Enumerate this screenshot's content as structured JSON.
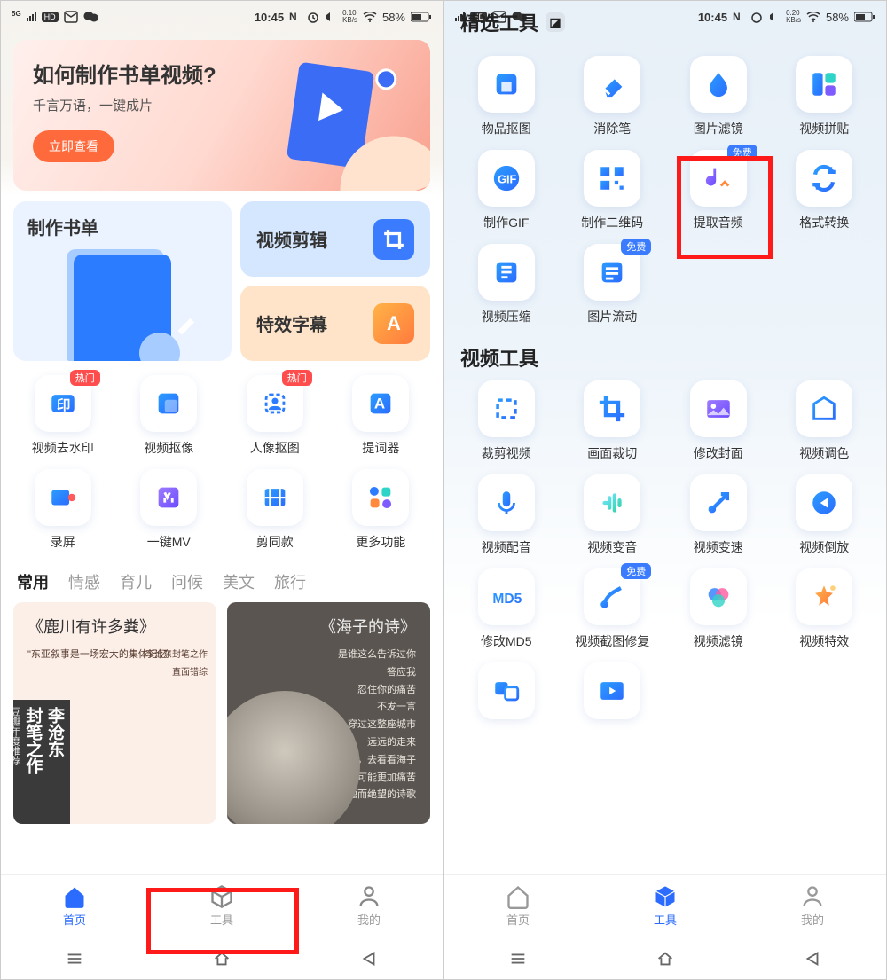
{
  "status": {
    "net": "5G",
    "hd": "HD",
    "time": "10:45",
    "speed_l": "0.10",
    "speed_unit": "KB/s",
    "speed_r": "0.20",
    "battery": "58%"
  },
  "left": {
    "banner": {
      "title": "如何制作书单视频?",
      "subtitle": "千言万语，一键成片",
      "cta": "立即查看"
    },
    "cards": {
      "big": "制作书单",
      "video_edit": "视频剪辑",
      "fx": "特效字幕"
    },
    "badges": {
      "hot": "热门"
    },
    "tools": [
      {
        "label": "视频去水印",
        "hot": true,
        "icon": "watermark"
      },
      {
        "label": "视频抠像",
        "icon": "cutout"
      },
      {
        "label": "人像抠图",
        "hot": true,
        "icon": "portrait"
      },
      {
        "label": "提词器",
        "icon": "prompter"
      },
      {
        "label": "录屏",
        "icon": "record"
      },
      {
        "label": "一键MV",
        "icon": "mv"
      },
      {
        "label": "剪同款",
        "icon": "film"
      },
      {
        "label": "更多功能",
        "icon": "more"
      }
    ],
    "tabs": [
      "常用",
      "情感",
      "育儿",
      "问候",
      "美文",
      "旅行"
    ],
    "card1": {
      "title": "《鹿川有许多粪》",
      "quote": "\"东亚叙事是一场宏大的集体记忆\"",
      "line1": "李沧东封笔之作",
      "line2": "直面错综",
      "strip_big": "李沧东",
      "strip_mid": "封笔之作",
      "strip_small": "豆瓣年度推荐"
    },
    "card2": {
      "title": "《海子的诗》",
      "lines": [
        "是谁这么告诉过你",
        "答应我",
        "忍住你的痛苦",
        "不发一言",
        "穿过这整座城市",
        "远远的走来",
        "去看着他，去看看海子",
        "他可能更加痛苦",
        "在写一首孤独而绝望的诗歌"
      ]
    },
    "nav": {
      "home": "首页",
      "tools": "工具",
      "mine": "我的"
    }
  },
  "right": {
    "header1": "精选工具",
    "header2": "视频工具",
    "badges": {
      "free": "免费"
    },
    "grid1": [
      {
        "label": "物品抠图",
        "icon": "box"
      },
      {
        "label": "消除笔",
        "icon": "eraser"
      },
      {
        "label": "图片滤镜",
        "icon": "drop"
      },
      {
        "label": "视频拼贴",
        "icon": "collage"
      },
      {
        "label": "制作GIF",
        "icon": "gif"
      },
      {
        "label": "制作二维码",
        "icon": "qr"
      },
      {
        "label": "提取音频",
        "icon": "audio",
        "free": true,
        "highlight": true
      },
      {
        "label": "格式转换",
        "icon": "convert"
      },
      {
        "label": "视频压缩",
        "icon": "compress"
      },
      {
        "label": "图片流动",
        "icon": "flow",
        "free": true
      }
    ],
    "grid2": [
      {
        "label": "裁剪视频",
        "icon": "trim"
      },
      {
        "label": "画面裁切",
        "icon": "crop"
      },
      {
        "label": "修改封面",
        "icon": "cover"
      },
      {
        "label": "视频调色",
        "icon": "tint"
      },
      {
        "label": "视频配音",
        "icon": "mic"
      },
      {
        "label": "视频变音",
        "icon": "voice"
      },
      {
        "label": "视频变速",
        "icon": "speed"
      },
      {
        "label": "视频倒放",
        "icon": "reverse"
      },
      {
        "label": "修改MD5",
        "icon": "md5"
      },
      {
        "label": "视频截图修复",
        "icon": "repair",
        "free": true
      },
      {
        "label": "视频滤镜",
        "icon": "vfilter"
      },
      {
        "label": "视频特效",
        "icon": "vfx"
      },
      {
        "label": "",
        "icon": "swap"
      },
      {
        "label": "",
        "icon": "play2"
      }
    ],
    "nav": {
      "home": "首页",
      "tools": "工具",
      "mine": "我的"
    }
  }
}
